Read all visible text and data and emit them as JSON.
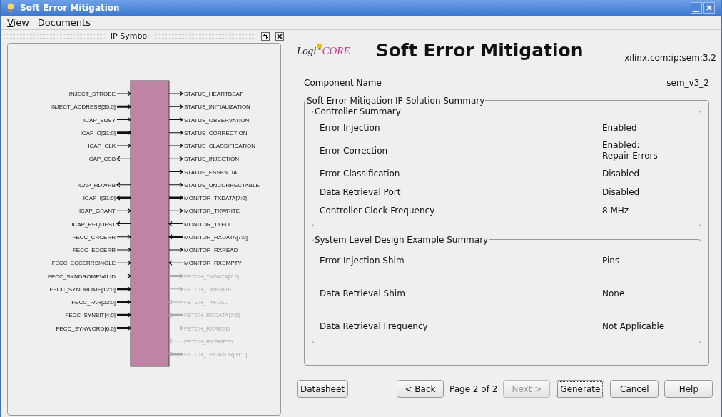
{
  "window": {
    "title": "Soft Error Mitigation"
  },
  "menu": [
    {
      "label": "View",
      "mnemonic": true
    },
    {
      "label": "Documents",
      "mnemonic": false
    }
  ],
  "symbol_panel": {
    "title": "IP Symbol",
    "left_ports": [
      {
        "kind": "pin",
        "name": "INJECT_STROBE",
        "output": false,
        "bus": false,
        "disabled": false
      },
      {
        "kind": "pin",
        "name": "INJECT_ADDRESS[35:0]",
        "output": false,
        "bus": true,
        "disabled": false
      },
      {
        "kind": "pin",
        "name": "ICAP_BUSY",
        "output": false,
        "bus": false,
        "disabled": false
      },
      {
        "kind": "pin",
        "name": "ICAP_O[31:0]",
        "output": false,
        "bus": true,
        "disabled": false
      },
      {
        "kind": "pin",
        "name": "ICAP_CLK",
        "output": false,
        "bus": false,
        "disabled": false
      },
      {
        "kind": "pin",
        "name": "ICAP_CSB",
        "output": true,
        "bus": false,
        "disabled": false
      },
      {
        "kind": "gap"
      },
      {
        "kind": "pin",
        "name": "ICAP_RDWRB",
        "output": true,
        "bus": false,
        "disabled": false
      },
      {
        "kind": "pin",
        "name": "ICAP_I[31:0]",
        "output": true,
        "bus": true,
        "disabled": false
      },
      {
        "kind": "pin",
        "name": "ICAP_GRANT",
        "output": false,
        "bus": false,
        "disabled": false
      },
      {
        "kind": "pin",
        "name": "ICAP_REQUEST",
        "output": true,
        "bus": false,
        "disabled": false
      },
      {
        "kind": "pin",
        "name": "FECC_CRCERR",
        "output": false,
        "bus": false,
        "disabled": false
      },
      {
        "kind": "pin",
        "name": "FECC_ECCERR",
        "output": false,
        "bus": false,
        "disabled": false
      },
      {
        "kind": "pin",
        "name": "FECC_ECCERRSINGLE",
        "output": false,
        "bus": false,
        "disabled": false
      },
      {
        "kind": "pin",
        "name": "FECC_SYNDROMEVALID",
        "output": false,
        "bus": false,
        "disabled": false
      },
      {
        "kind": "pin",
        "name": "FECC_SYNDROME[12:0]",
        "output": false,
        "bus": true,
        "disabled": false
      },
      {
        "kind": "pin",
        "name": "FECC_FAR[23:0]",
        "output": false,
        "bus": true,
        "disabled": false
      },
      {
        "kind": "pin",
        "name": "FECC_SYNBIT[4:0]",
        "output": false,
        "bus": true,
        "disabled": false
      },
      {
        "kind": "pin",
        "name": "FECC_SYNWORD[6:0]",
        "output": false,
        "bus": true,
        "disabled": false
      }
    ],
    "right_ports": [
      {
        "kind": "pin",
        "name": "STATUS_HEARTBEAT",
        "output": true,
        "bus": false,
        "disabled": false
      },
      {
        "kind": "pin",
        "name": "STATUS_INITIALIZATION",
        "output": true,
        "bus": false,
        "disabled": false
      },
      {
        "kind": "pin",
        "name": "STATUS_OBSERVATION",
        "output": true,
        "bus": false,
        "disabled": false
      },
      {
        "kind": "pin",
        "name": "STATUS_CORRECTION",
        "output": true,
        "bus": false,
        "disabled": false
      },
      {
        "kind": "pin",
        "name": "STATUS_CLASSIFICATION",
        "output": true,
        "bus": false,
        "disabled": false
      },
      {
        "kind": "pin",
        "name": "STATUS_INJECTION",
        "output": true,
        "bus": false,
        "disabled": false
      },
      {
        "kind": "pin",
        "name": "STATUS_ESSENTIAL",
        "output": true,
        "bus": false,
        "disabled": false
      },
      {
        "kind": "pin",
        "name": "STATUS_UNCORRECTABLE",
        "output": true,
        "bus": false,
        "disabled": false
      },
      {
        "kind": "pin",
        "name": "MONITOR_TXDATA[7:0]",
        "output": true,
        "bus": true,
        "disabled": false
      },
      {
        "kind": "pin",
        "name": "MONITOR_TXWRITE",
        "output": true,
        "bus": false,
        "disabled": false
      },
      {
        "kind": "pin",
        "name": "MONITOR_TXFULL",
        "output": false,
        "bus": false,
        "disabled": false
      },
      {
        "kind": "pin",
        "name": "MONITOR_RXDATA[7:0]",
        "output": false,
        "bus": true,
        "disabled": false
      },
      {
        "kind": "pin",
        "name": "MONITOR_RXREAD",
        "output": true,
        "bus": false,
        "disabled": false
      },
      {
        "kind": "pin",
        "name": "MONITOR_RXEMPTY",
        "output": false,
        "bus": false,
        "disabled": false
      },
      {
        "kind": "pin",
        "name": "FETCH_TXDATA[7:0]",
        "output": true,
        "bus": true,
        "disabled": true
      },
      {
        "kind": "pin",
        "name": "FETCH_TXWRITE",
        "output": true,
        "bus": false,
        "disabled": true
      },
      {
        "kind": "pin",
        "name": "FETCH_TXFULL",
        "output": false,
        "bus": false,
        "disabled": true
      },
      {
        "kind": "pin",
        "name": "FETCH_RXDATA[7:0]",
        "output": false,
        "bus": true,
        "disabled": true
      },
      {
        "kind": "pin",
        "name": "FETCH_RXREAD",
        "output": true,
        "bus": false,
        "disabled": true
      },
      {
        "kind": "pin",
        "name": "FETCH_RXEMPTY",
        "output": false,
        "bus": false,
        "disabled": true
      },
      {
        "kind": "pin",
        "name": "FETCH_TBLADDR[31:0]",
        "output": false,
        "bus": true,
        "disabled": true
      }
    ]
  },
  "header": {
    "logo_prefix": "Logi",
    "logo_suffix": "CORE",
    "title": "Soft Error Mitigation",
    "vlnv": "xilinx.com:ip:sem:3.2"
  },
  "component": {
    "label": "Component Name",
    "value": "sem_v3_2"
  },
  "summary": {
    "title": "Soft Error Mitigation IP Solution Summary",
    "groups": [
      {
        "title": "Controller Summary",
        "spacious": false,
        "rows": [
          {
            "label": "Error Injection",
            "value": "Enabled"
          },
          {
            "label": "Error Correction",
            "value": "Enabled:\nRepair Errors"
          },
          {
            "label": "Error Classification",
            "value": "Disabled"
          },
          {
            "label": "Data Retrieval Port",
            "value": "Disabled"
          },
          {
            "label": "Controller Clock Frequency",
            "value": "8 MHz"
          }
        ]
      },
      {
        "title": "System Level Design Example Summary",
        "spacious": true,
        "rows": [
          {
            "label": "Error Injection Shim",
            "value": "Pins"
          },
          {
            "label": "Data Retrieval Shim",
            "value": "None"
          },
          {
            "label": "Data Retrieval Frequency",
            "value": "Not Applicable"
          }
        ]
      }
    ]
  },
  "buttons": [
    {
      "kind": "datasheet",
      "label": "Datasheet",
      "mnemonic": true,
      "disabled": false,
      "focused": false
    },
    {
      "kind": "nav",
      "label": "< Back",
      "mnemonic": true,
      "disabled": false,
      "focused": false
    },
    {
      "kind": "page",
      "label": "Page 2 of 2"
    },
    {
      "kind": "nav",
      "label": "Next >",
      "mnemonic": true,
      "disabled": true,
      "focused": false
    },
    {
      "kind": "action",
      "label": "Generate",
      "mnemonic": true,
      "disabled": false,
      "focused": true
    },
    {
      "kind": "action",
      "label": "Cancel",
      "mnemonic": true,
      "disabled": false,
      "focused": false
    },
    {
      "kind": "action",
      "label": "Help",
      "mnemonic": true,
      "disabled": false,
      "focused": false
    }
  ]
}
